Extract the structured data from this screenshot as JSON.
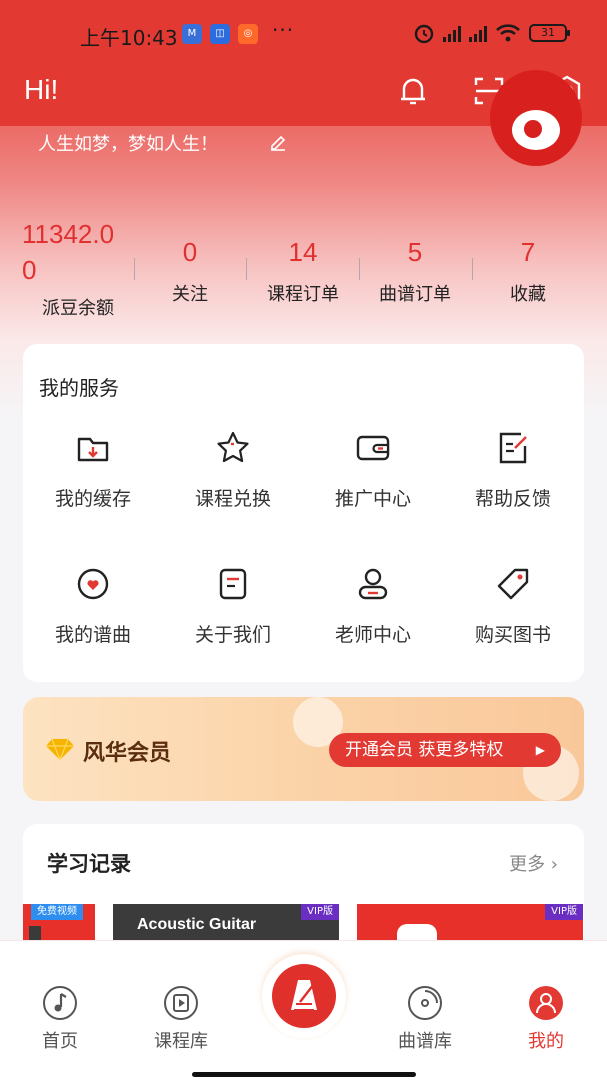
{
  "status_bar": {
    "time": "上午10:43",
    "dots": "···",
    "battery": "31"
  },
  "header": {
    "greeting": "Hi!"
  },
  "profile": {
    "motto": "人生如梦，梦如人生！"
  },
  "stats": [
    {
      "value_line1": "11342.0",
      "value_line2": "0",
      "label": "派豆余额"
    },
    {
      "value": "0",
      "label": "关注"
    },
    {
      "value": "14",
      "label": "课程订单"
    },
    {
      "value": "5",
      "label": "曲谱订单"
    },
    {
      "value": "7",
      "label": "收藏"
    }
  ],
  "services": {
    "title": "我的服务",
    "items": [
      {
        "label": "我的缓存",
        "icon": "folder-download-icon"
      },
      {
        "label": "课程兑换",
        "icon": "star-icon"
      },
      {
        "label": "推广中心",
        "icon": "wallet-icon"
      },
      {
        "label": "帮助反馈",
        "icon": "feedback-edit-icon"
      },
      {
        "label": "我的谱曲",
        "icon": "heart-disc-icon"
      },
      {
        "label": "关于我们",
        "icon": "document-icon"
      },
      {
        "label": "老师中心",
        "icon": "user-icon"
      },
      {
        "label": "购买图书",
        "icon": "tag-icon"
      }
    ]
  },
  "vip": {
    "title": "风华会员",
    "button": "开通会员 获更多特权",
    "arrow": "▶"
  },
  "learning": {
    "title": "学习记录",
    "more": "更多 ›",
    "thumbs": [
      {
        "tag": "免费视频"
      },
      {
        "tag": "VIP版",
        "text": "Acoustic Guitar"
      },
      {
        "tag": "VIP版"
      }
    ]
  },
  "tabs": [
    {
      "label": "首页",
      "icon": "music-note-icon"
    },
    {
      "label": "课程库",
      "icon": "play-book-icon"
    },
    {
      "label": "",
      "icon": "metronome-icon"
    },
    {
      "label": "曲谱库",
      "icon": "disc-icon"
    },
    {
      "label": "我的",
      "icon": "person-icon"
    }
  ],
  "colors": {
    "accent": "#e23a33",
    "vip_text": "#5a2d10"
  }
}
